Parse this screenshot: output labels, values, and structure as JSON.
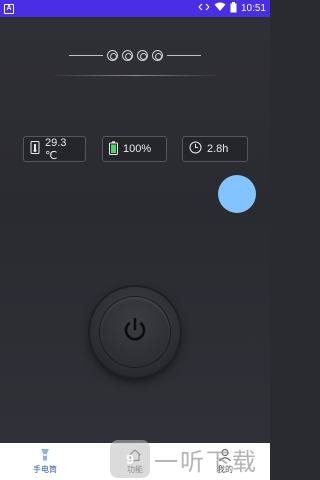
{
  "statusbar": {
    "left_badge": "A",
    "time": "10:51"
  },
  "info": {
    "temperature": "29.3 ℃",
    "battery": "100%",
    "time_left": "2.8h"
  },
  "nav": {
    "items": [
      {
        "label": "手电筒",
        "icon": "flashlight-icon",
        "active": true
      },
      {
        "label": "功能",
        "icon": "home-icon",
        "active": false
      },
      {
        "label": "我的",
        "icon": "person-icon",
        "active": false
      }
    ]
  },
  "watermark": {
    "text": "一听下载"
  },
  "colors": {
    "statusbar": "#4a2ee6",
    "accent_circle": "#83c3ff",
    "background": "#2a2b30"
  }
}
